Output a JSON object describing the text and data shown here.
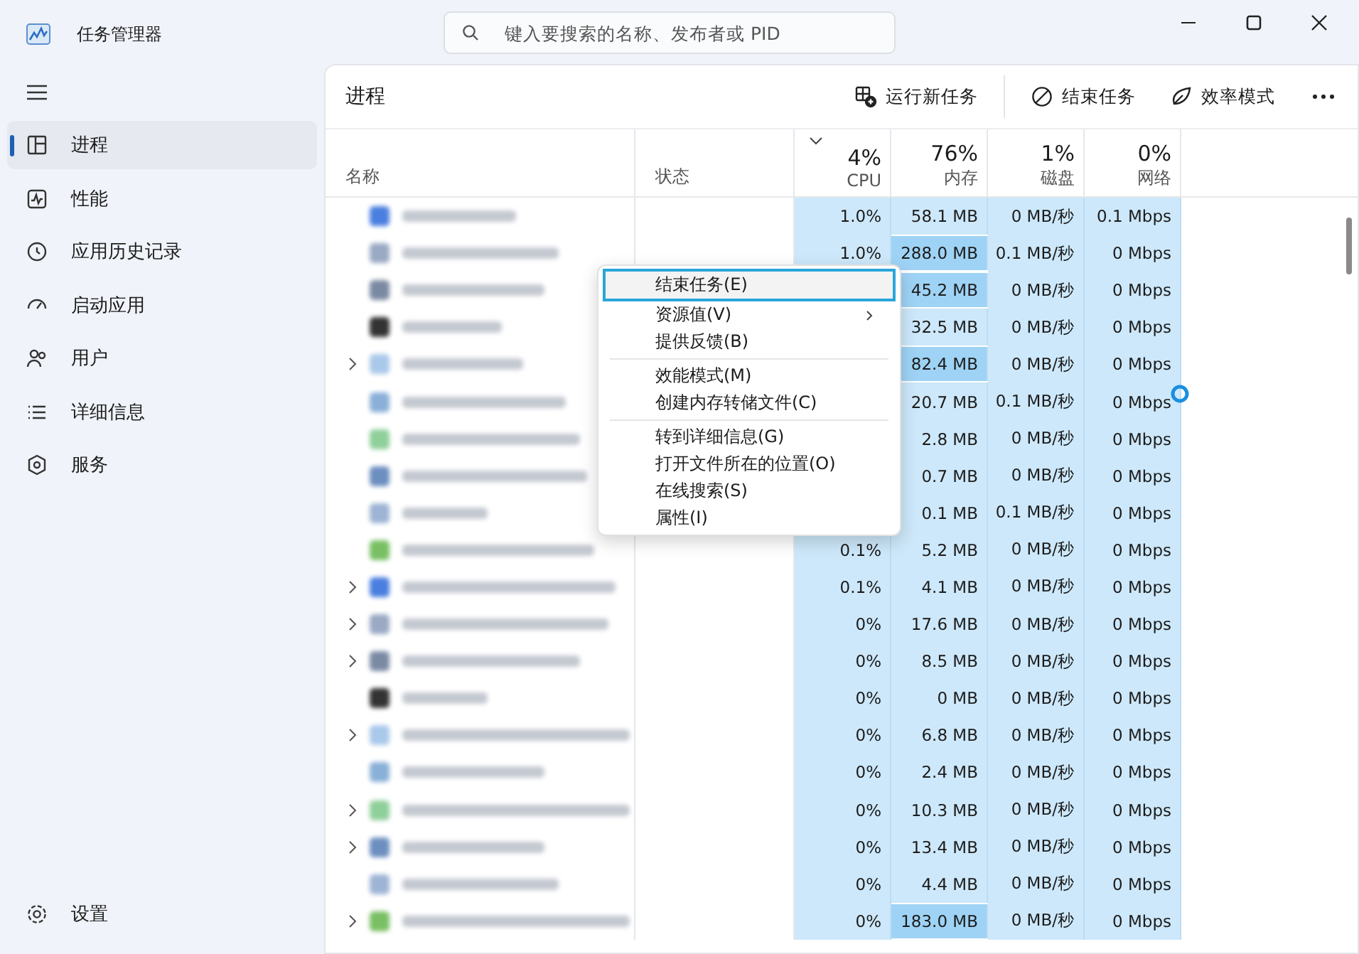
{
  "window": {
    "title": "任务管理器"
  },
  "search": {
    "placeholder": "键入要搜索的名称、发布者或 PID"
  },
  "sidebar": {
    "items": [
      {
        "label": "进程",
        "selected": true
      },
      {
        "label": "性能",
        "selected": false
      },
      {
        "label": "应用历史记录",
        "selected": false
      },
      {
        "label": "启动应用",
        "selected": false
      },
      {
        "label": "用户",
        "selected": false
      },
      {
        "label": "详细信息",
        "selected": false
      },
      {
        "label": "服务",
        "selected": false
      }
    ],
    "footer": {
      "label": "设置"
    }
  },
  "page": {
    "title": "进程"
  },
  "toolbar": [
    {
      "label": "运行新任务"
    },
    {
      "label": "结束任务"
    },
    {
      "label": "效率模式"
    }
  ],
  "table": {
    "columns": [
      {
        "label": "名称"
      },
      {
        "label": "状态"
      },
      {
        "label": "CPU",
        "total": "4%",
        "sorted": true
      },
      {
        "label": "内存",
        "total": "76%",
        "sorted": false
      },
      {
        "label": "磁盘",
        "total": "1%",
        "sorted": false
      },
      {
        "label": "网络",
        "total": "0%",
        "sorted": false
      }
    ],
    "rows": [
      {
        "expandable": false,
        "cpu": "1.0%",
        "memory": "58.1 MB",
        "memory_high": false,
        "disk": "0 MB/秒",
        "network": "0.1 Mbps"
      },
      {
        "expandable": false,
        "cpu": "1.0%",
        "memory": "288.0 MB",
        "memory_high": true,
        "disk": "0.1 MB/秒",
        "network": "0 Mbps"
      },
      {
        "expandable": false,
        "memory": "45.2 MB",
        "memory_high": true,
        "disk": "0 MB/秒",
        "network": "0 Mbps"
      },
      {
        "expandable": false,
        "memory": "32.5 MB",
        "memory_high": false,
        "disk": "0 MB/秒",
        "network": "0 Mbps"
      },
      {
        "expandable": true,
        "memory": "82.4 MB",
        "memory_high": true,
        "disk": "0 MB/秒",
        "network": "0 Mbps"
      },
      {
        "expandable": false,
        "memory": "20.7 MB",
        "memory_high": false,
        "disk": "0.1 MB/秒",
        "network": "0 Mbps"
      },
      {
        "expandable": false,
        "memory": "2.8 MB",
        "memory_high": false,
        "disk": "0 MB/秒",
        "network": "0 Mbps"
      },
      {
        "expandable": false,
        "memory": "0.7 MB",
        "memory_high": false,
        "disk": "0 MB/秒",
        "network": "0 Mbps"
      },
      {
        "expandable": false,
        "memory": "0.1 MB",
        "memory_high": false,
        "disk": "0.1 MB/秒",
        "network": "0 Mbps"
      },
      {
        "expandable": false,
        "cpu": "0.1%",
        "memory": "5.2 MB",
        "memory_high": false,
        "disk": "0 MB/秒",
        "network": "0 Mbps"
      },
      {
        "expandable": true,
        "cpu": "0.1%",
        "memory": "4.1 MB",
        "memory_high": false,
        "disk": "0 MB/秒",
        "network": "0 Mbps"
      },
      {
        "expandable": true,
        "cpu": "0%",
        "memory": "17.6 MB",
        "memory_high": false,
        "disk": "0 MB/秒",
        "network": "0 Mbps"
      },
      {
        "expandable": true,
        "cpu": "0%",
        "memory": "8.5 MB",
        "memory_high": false,
        "disk": "0 MB/秒",
        "network": "0 Mbps"
      },
      {
        "expandable": false,
        "cpu": "0%",
        "memory": "0 MB",
        "memory_high": false,
        "disk": "0 MB/秒",
        "network": "0 Mbps"
      },
      {
        "expandable": true,
        "cpu": "0%",
        "memory": "6.8 MB",
        "memory_high": false,
        "disk": "0 MB/秒",
        "network": "0 Mbps"
      },
      {
        "expandable": false,
        "cpu": "0%",
        "memory": "2.4 MB",
        "memory_high": false,
        "disk": "0 MB/秒",
        "network": "0 Mbps"
      },
      {
        "expandable": true,
        "cpu": "0%",
        "memory": "10.3 MB",
        "memory_high": false,
        "disk": "0 MB/秒",
        "network": "0 Mbps"
      },
      {
        "expandable": true,
        "cpu": "0%",
        "memory": "13.4 MB",
        "memory_high": false,
        "disk": "0 MB/秒",
        "network": "0 Mbps"
      },
      {
        "expandable": false,
        "cpu": "0%",
        "memory": "4.4 MB",
        "memory_high": false,
        "disk": "0 MB/秒",
        "network": "0 Mbps"
      },
      {
        "expandable": true,
        "cpu": "0%",
        "memory": "183.0 MB",
        "memory_high": true,
        "disk": "0 MB/秒",
        "network": "0 Mbps"
      }
    ]
  },
  "context_menu": {
    "groups": [
      [
        {
          "label": "结束任务(E)",
          "selected": true,
          "submenu": false
        },
        {
          "label": "资源值(V)",
          "selected": false,
          "submenu": true
        },
        {
          "label": "提供反馈(B)",
          "selected": false,
          "submenu": false
        }
      ],
      [
        {
          "label": "效能模式(M)",
          "selected": false,
          "submenu": false
        },
        {
          "label": "创建内存转储文件(C)",
          "selected": false,
          "submenu": false
        }
      ],
      [
        {
          "label": "转到详细信息(G)",
          "selected": false,
          "submenu": false
        },
        {
          "label": "打开文件所在的位置(O)",
          "selected": false,
          "submenu": false
        },
        {
          "label": "在线搜索(S)",
          "selected": false,
          "submenu": false
        },
        {
          "label": "属性(I)",
          "selected": false,
          "submenu": false
        }
      ]
    ]
  }
}
